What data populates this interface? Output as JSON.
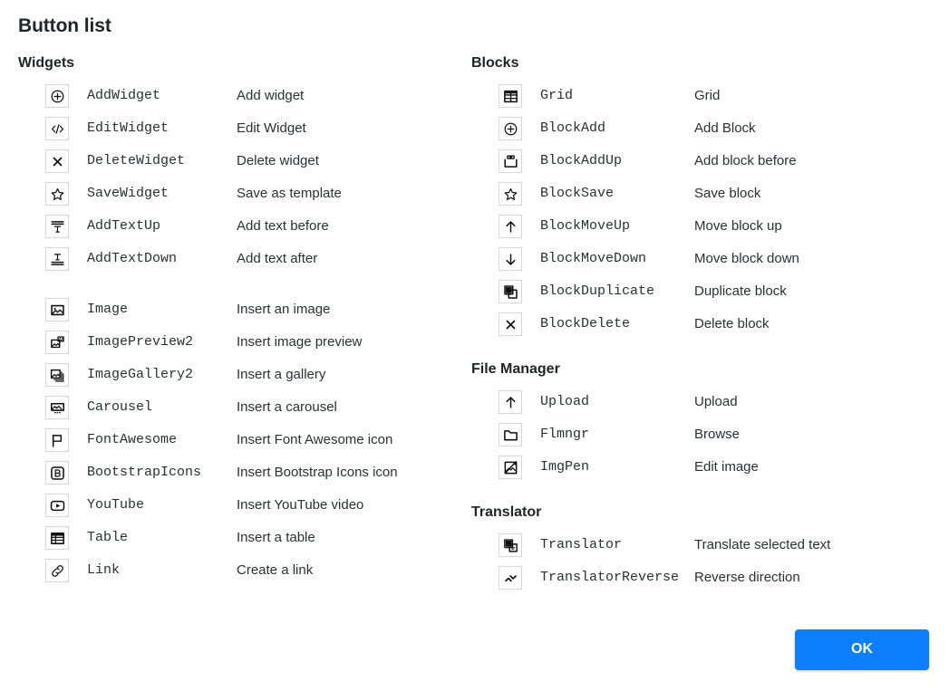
{
  "dialog": {
    "title": "Button list",
    "ok_label": "OK",
    "accent_color": "#0d7efd"
  },
  "columns": {
    "left": [
      {
        "title": "Widgets",
        "groups": [
          {
            "rows": [
              {
                "icon": "plus-circle-icon",
                "name": "AddWidget",
                "desc": "Add widget"
              },
              {
                "icon": "code-icon",
                "name": "EditWidget",
                "desc": "Edit Widget"
              },
              {
                "icon": "close-x-icon",
                "name": "DeleteWidget",
                "desc": "Delete widget"
              },
              {
                "icon": "star-icon",
                "name": "SaveWidget",
                "desc": "Save as template"
              },
              {
                "icon": "text-add-up-icon",
                "name": "AddTextUp",
                "desc": "Add text before"
              },
              {
                "icon": "text-add-down-icon",
                "name": "AddTextDown",
                "desc": "Add text after"
              }
            ]
          },
          {
            "rows": [
              {
                "icon": "image-icon",
                "name": "Image",
                "desc": "Insert an image"
              },
              {
                "icon": "image-preview-icon",
                "name": "ImagePreview2",
                "desc": "Insert image preview"
              },
              {
                "icon": "image-gallery-icon",
                "name": "ImageGallery2",
                "desc": "Insert a gallery"
              },
              {
                "icon": "carousel-icon",
                "name": "Carousel",
                "desc": "Insert a carousel"
              },
              {
                "icon": "flag-icon",
                "name": "FontAwesome",
                "desc": "Insert Font Awesome icon"
              },
              {
                "icon": "bootstrap-icon",
                "name": "BootstrapIcons",
                "desc": "Insert Bootstrap Icons icon"
              },
              {
                "icon": "youtube-icon",
                "name": "YouTube",
                "desc": "Insert YouTube video"
              },
              {
                "icon": "table-icon",
                "name": "Table",
                "desc": "Insert a table"
              },
              {
                "icon": "link-icon",
                "name": "Link",
                "desc": "Create a link"
              }
            ]
          }
        ]
      }
    ],
    "right": [
      {
        "title": "Blocks",
        "groups": [
          {
            "rows": [
              {
                "icon": "grid-icon",
                "name": "Grid",
                "desc": "Grid"
              },
              {
                "icon": "plus-circle-icon",
                "name": "BlockAdd",
                "desc": "Add Block"
              },
              {
                "icon": "block-add-up-icon",
                "name": "BlockAddUp",
                "desc": "Add block before"
              },
              {
                "icon": "star-icon",
                "name": "BlockSave",
                "desc": "Save block"
              },
              {
                "icon": "arrow-up-icon",
                "name": "BlockMoveUp",
                "desc": "Move block up"
              },
              {
                "icon": "arrow-down-icon",
                "name": "BlockMoveDown",
                "desc": "Move block down"
              },
              {
                "icon": "duplicate-icon",
                "name": "BlockDuplicate",
                "desc": "Duplicate block"
              },
              {
                "icon": "close-x-icon",
                "name": "BlockDelete",
                "desc": "Delete block"
              }
            ]
          }
        ]
      },
      {
        "title": "File Manager",
        "groups": [
          {
            "rows": [
              {
                "icon": "arrow-up-icon",
                "name": "Upload",
                "desc": "Upload"
              },
              {
                "icon": "folder-icon",
                "name": "Flmngr",
                "desc": "Browse"
              },
              {
                "icon": "image-pen-icon",
                "name": "ImgPen",
                "desc": "Edit image"
              }
            ]
          }
        ]
      },
      {
        "title": "Translator",
        "groups": [
          {
            "rows": [
              {
                "icon": "translate-icon",
                "name": "Translator",
                "desc": "Translate selected text"
              },
              {
                "icon": "chevron-updown-icon",
                "name": "TranslatorReverse",
                "desc": "Reverse direction"
              },
              {
                "icon": "blank-icon",
                "name": "",
                "desc": ""
              }
            ]
          }
        ]
      }
    ]
  }
}
